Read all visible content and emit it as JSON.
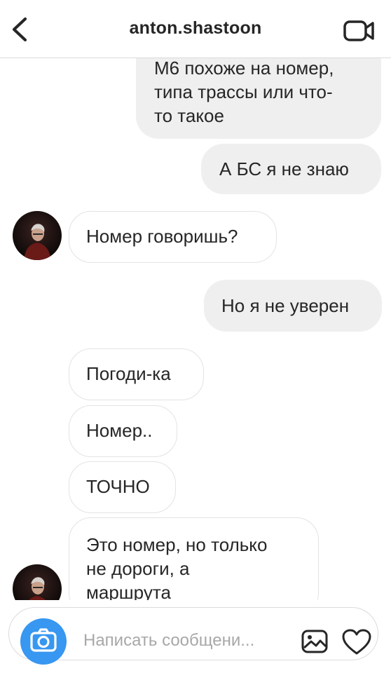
{
  "header": {
    "back_icon": "chevron-left-icon",
    "title": "anton.shastoon",
    "video_icon": "video-camera-icon"
  },
  "messages": [
    {
      "direction": "outgoing",
      "lines": [
        "М6 похоже на номер,",
        "типа трассы или что-",
        "то такое"
      ]
    },
    {
      "direction": "outgoing",
      "lines": [
        "А БС я не знаю"
      ]
    },
    {
      "direction": "incoming",
      "lines": [
        "Номер говоришь?"
      ]
    },
    {
      "direction": "outgoing",
      "lines": [
        "Но я не уверен"
      ]
    },
    {
      "direction": "incoming",
      "lines": [
        "Погоди-ка"
      ]
    },
    {
      "direction": "incoming",
      "lines": [
        "Номер.."
      ]
    },
    {
      "direction": "incoming",
      "lines": [
        "ТОЧНО"
      ]
    },
    {
      "direction": "incoming",
      "lines": [
        "Это номер, но только",
        "не дороги, а",
        "маршрута"
      ]
    }
  ],
  "composer": {
    "camera_icon": "camera-icon",
    "placeholder": "Написать сообщени...",
    "value": "",
    "gallery_icon": "gallery-icon",
    "heart_icon": "heart-icon"
  },
  "colors": {
    "outgoing_bubble": "#efefef",
    "incoming_border": "#e3e3e3",
    "accent": "#3897f0",
    "text": "#262626",
    "placeholder": "#a8a8a8"
  }
}
